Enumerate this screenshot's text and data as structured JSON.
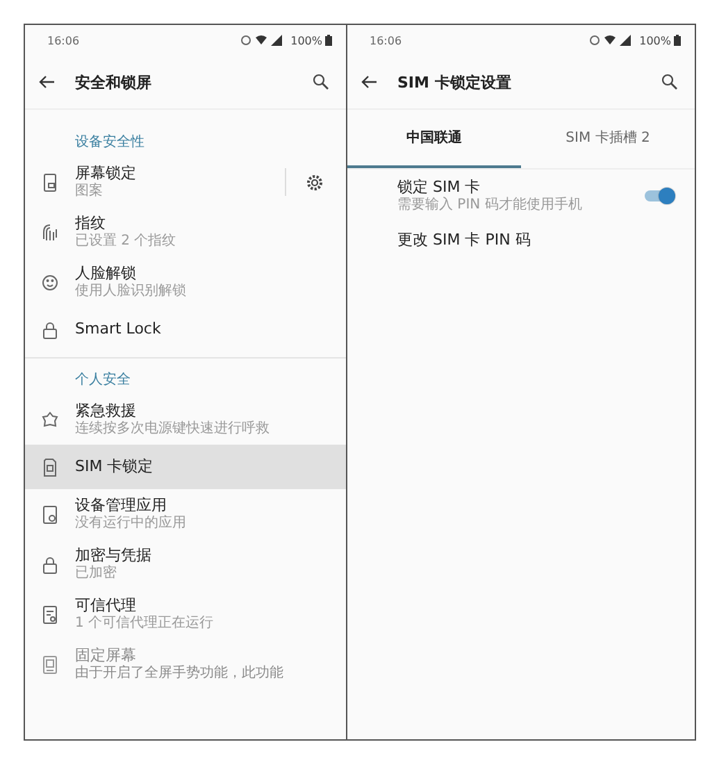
{
  "left_screen": {
    "status_bar": {
      "time": "16:06",
      "battery": "100%"
    },
    "title": "安全和锁屏",
    "sections": [
      {
        "header": "设备安全性",
        "items": [
          {
            "kind": "with_settings",
            "title": "屏幕锁定",
            "subtitle": "图案",
            "selected": false,
            "disabled": false
          },
          {
            "kind": "plain",
            "title": "指纹",
            "subtitle": "已设置 2 个指纹",
            "selected": false,
            "disabled": false
          },
          {
            "kind": "plain",
            "title": "人脸解锁",
            "subtitle": "使用人脸识别解锁",
            "selected": false,
            "disabled": false
          },
          {
            "kind": "plain",
            "title": "Smart Lock",
            "selected": false,
            "disabled": false
          }
        ]
      },
      {
        "header": "个人安全",
        "items": [
          {
            "kind": "plain",
            "title": "紧急救援",
            "subtitle": "连续按多次电源键快速进行呼救",
            "selected": false,
            "disabled": false
          },
          {
            "kind": "plain",
            "title": "SIM 卡锁定",
            "selected": true,
            "disabled": false
          },
          {
            "kind": "plain",
            "title": "设备管理应用",
            "subtitle": "没有运行中的应用",
            "selected": false,
            "disabled": false
          },
          {
            "kind": "plain",
            "title": "加密与凭据",
            "subtitle": "已加密",
            "selected": false,
            "disabled": false
          },
          {
            "kind": "plain",
            "title": "可信代理",
            "subtitle": "1 个可信代理正在运行",
            "selected": false,
            "disabled": false
          },
          {
            "kind": "plain",
            "title": "固定屏幕",
            "subtitle": "由于开启了全屏手势功能，此功能",
            "selected": false,
            "disabled": true
          }
        ]
      }
    ]
  },
  "right_screen": {
    "status_bar": {
      "time": "16:06",
      "battery": "100%"
    },
    "title": "SIM 卡锁定设置",
    "tabs": [
      {
        "label": "中国联通",
        "selected": true
      },
      {
        "label": "SIM 卡插槽 2",
        "selected": false
      }
    ],
    "settings": [
      {
        "kind": "toggle",
        "title": "锁定 SIM 卡",
        "subtitle": "需要输入 PIN 码才能使用手机",
        "on": true
      },
      {
        "kind": "plain",
        "title": "更改 SIM 卡 PIN 码"
      }
    ]
  }
}
